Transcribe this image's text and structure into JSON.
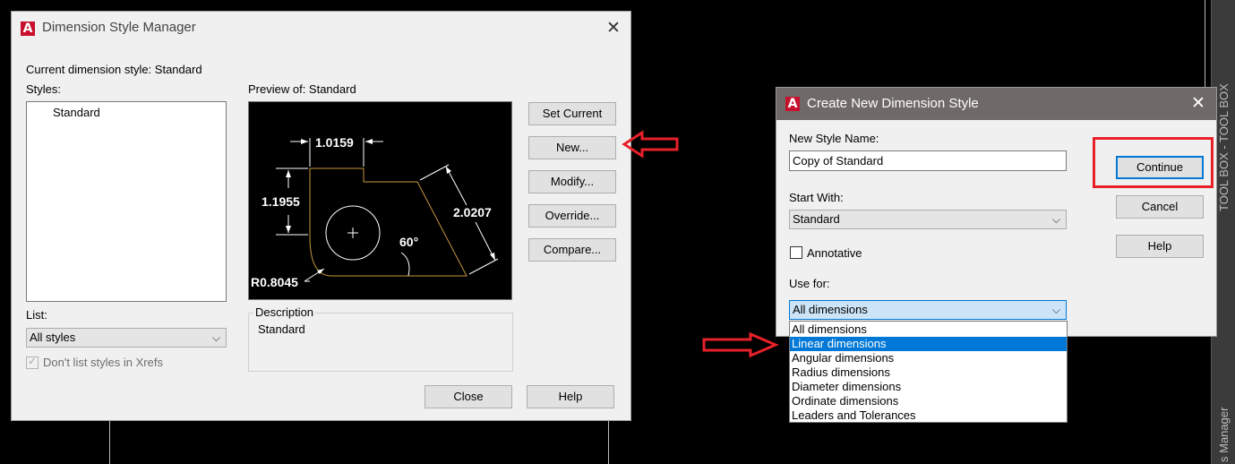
{
  "dim_manager": {
    "title": "Dimension Style Manager",
    "current_style_label": "Current dimension style: Standard",
    "styles_label": "Styles:",
    "styles_items": [
      "Standard"
    ],
    "preview_label": "Preview of: Standard",
    "preview_dims": {
      "top": "1.0159",
      "left": "1.1955",
      "diag": "2.0207",
      "angle": "60°",
      "radius": "R0.8045"
    },
    "buttons": {
      "set_current": "Set Current",
      "new": "New...",
      "modify": "Modify...",
      "override": "Override...",
      "compare": "Compare...",
      "close": "Close",
      "help": "Help"
    },
    "list_label": "List:",
    "list_value": "All styles",
    "dont_list_xrefs": "Don't list styles in Xrefs",
    "description_label": "Description",
    "description_value": "Standard"
  },
  "create_dialog": {
    "title": "Create New Dimension Style",
    "new_style_name_label": "New Style Name:",
    "new_style_name_value": "Copy of Standard",
    "start_with_label": "Start With:",
    "start_with_value": "Standard",
    "annotative_label": "Annotative",
    "use_for_label": "Use for:",
    "use_for_value": "All dimensions",
    "use_for_options": [
      "All dimensions",
      "Linear dimensions",
      "Angular dimensions",
      "Radius dimensions",
      "Diameter dimensions",
      "Ordinate dimensions",
      "Leaders and Tolerances"
    ],
    "use_for_highlighted_index": 1,
    "buttons": {
      "continue": "Continue",
      "cancel": "Cancel",
      "help": "Help"
    }
  },
  "side_bar": {
    "tool_box_text": "TOOL BOX - TOOL BOX",
    "manager_text": "s Manager"
  },
  "colors": {
    "annotation_red": "#e8202a",
    "selection_blue": "#0078d7",
    "preview_outline": "#c8963e"
  }
}
